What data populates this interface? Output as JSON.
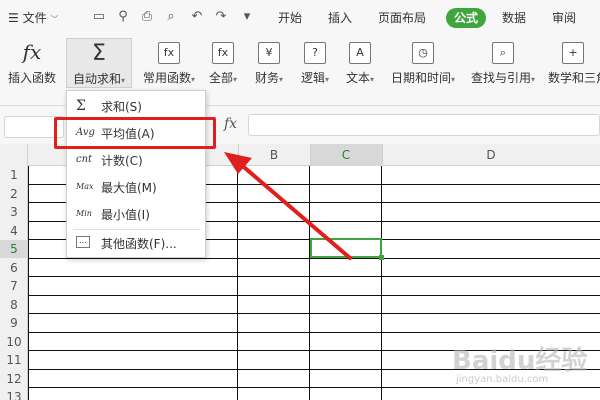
{
  "menubar": {
    "hamburger_label": "文件",
    "tabs": [
      "开始",
      "插入",
      "页面布局",
      "公式",
      "数据",
      "审阅"
    ],
    "active_tab": "公式",
    "colors": {
      "accent": "#3fa63d",
      "highlight": "#e0201c"
    }
  },
  "ribbon": {
    "tools": [
      {
        "label": "插入函数",
        "icon": "fx-icon"
      },
      {
        "label": "自动求和",
        "icon": "sigma-icon"
      },
      {
        "label": "常用函数",
        "icon": "function-star-icon"
      },
      {
        "label": "全部",
        "icon": "fx-doc-icon"
      },
      {
        "label": "财务",
        "icon": "yen-book-icon"
      },
      {
        "label": "逻辑",
        "icon": "question-book-icon"
      },
      {
        "label": "文本",
        "icon": "text-book-icon"
      },
      {
        "label": "日期和时间",
        "icon": "clock-book-icon"
      },
      {
        "label": "查找与引用",
        "icon": "search-book-icon"
      },
      {
        "label": "数学和三角",
        "icon": "plus-book-icon"
      }
    ]
  },
  "formula_bar": {
    "fx": "fx",
    "value": ""
  },
  "grid": {
    "columns": [
      "B",
      "C",
      "D"
    ],
    "rows": [
      "1",
      "2",
      "3",
      "4",
      "5",
      "6",
      "7",
      "8",
      "9",
      "10",
      "11",
      "12",
      "13"
    ],
    "selected_cell": "C5"
  },
  "dropdown": {
    "items": [
      {
        "icon_text": "Σ",
        "label": "求和(S)"
      },
      {
        "icon_text": "Avg",
        "label": "平均值(A)"
      },
      {
        "icon_text": "cnt",
        "label": "计数(C)"
      },
      {
        "icon_text": "Max",
        "label": "最大值(M)"
      },
      {
        "icon_text": "Min",
        "label": "最小值(I)"
      },
      {
        "icon_text": "…",
        "label": "其他函数(F)..."
      }
    ],
    "highlighted": "平均值(A)"
  },
  "watermark": {
    "text": "Baidu经验",
    "sub": "jingyan.baidu.com"
  }
}
